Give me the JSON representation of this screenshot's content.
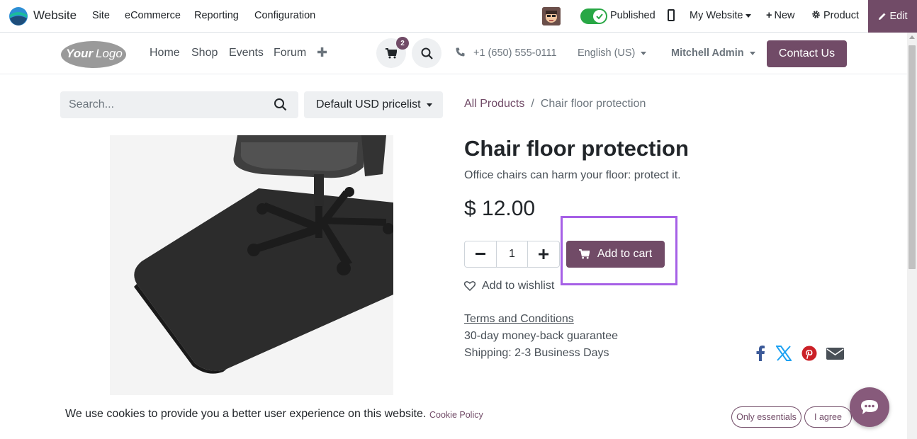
{
  "adminbar": {
    "app_name": "Website",
    "menus": [
      "Site",
      "eCommerce",
      "Reporting",
      "Configuration"
    ],
    "published_label": "Published",
    "my_website_label": "My Website",
    "new_label": "New",
    "product_label": "Product",
    "edit_label": "Edit"
  },
  "header": {
    "logo_text": "YourLogo",
    "nav": [
      "Home",
      "Shop",
      "Events",
      "Forum"
    ],
    "cart_count": "2",
    "phone": "+1 (650) 555-0111",
    "language": "English (US)",
    "user": "Mitchell Admin",
    "contact_label": "Contact Us"
  },
  "shop": {
    "search_placeholder": "Search...",
    "pricelist": "Default USD pricelist",
    "breadcrumb": {
      "parent": "All Products",
      "separator": "/",
      "current": "Chair floor protection"
    }
  },
  "product": {
    "name": "Chair floor protection",
    "description": "Office chairs can harm your floor: protect it.",
    "price": "$ 12.00",
    "quantity": "1",
    "add_to_cart_label": "Add to cart",
    "wishlist_label": "Add to wishlist",
    "terms_label": "Terms and Conditions",
    "guarantee": "30-day money-back guarantee",
    "shipping": "Shipping: 2-3 Business Days",
    "share_icons": [
      "facebook-icon",
      "x-twitter-icon",
      "pinterest-icon",
      "email-icon"
    ]
  },
  "cookies": {
    "message": "We use cookies to provide you a better user experience on this website.",
    "policy_label": "Cookie Policy",
    "essentials_label": "Only essentials",
    "agree_label": "I agree"
  },
  "colors": {
    "brand": "#714b67",
    "published_toggle": "#28a745",
    "highlight": "#a660e6",
    "facebook": "#3b5998",
    "x": "#1da1f2",
    "pinterest": "#cb2027",
    "email": "#495057"
  }
}
